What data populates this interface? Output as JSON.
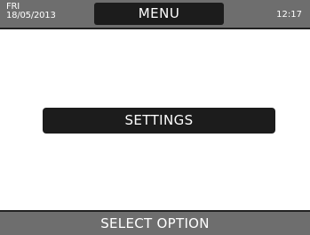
{
  "header": {
    "day": "FRI",
    "date": "18/05/2013",
    "title": "MENU",
    "time": "12:17"
  },
  "menu": {
    "items": [
      {
        "label": "SETTINGS"
      }
    ]
  },
  "footer": {
    "status": "SELECT OPTION"
  },
  "colors": {
    "bar_gray": "#6e6e6e",
    "button_black": "#1c1c1c",
    "background": "#ffffff",
    "text": "#ffffff"
  }
}
